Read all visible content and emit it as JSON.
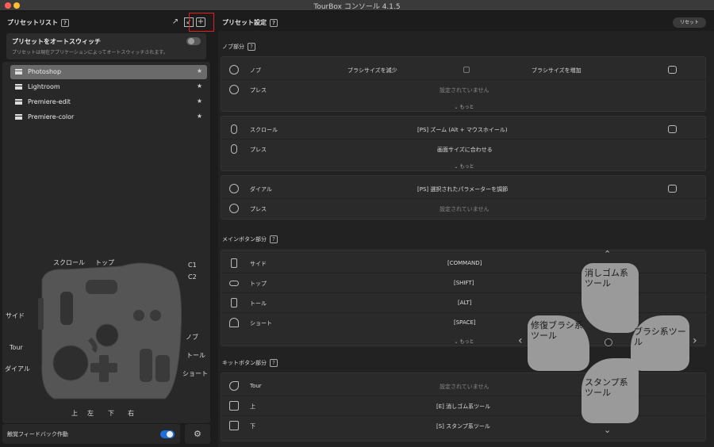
{
  "window": {
    "title": "TourBox コンソール 4.1.5"
  },
  "presets": {
    "header": "プリセットリスト",
    "help": "?",
    "auto_switch_title": "プリセットをオートスウィッチ",
    "auto_switch_desc": "プリセットは現在アプリケーションによってオートスウィッチされます。",
    "items": [
      {
        "label": "Photoshop",
        "star": "★"
      },
      {
        "label": "Lightroom",
        "star": "★"
      },
      {
        "label": "Premiere-edit",
        "star": "★"
      },
      {
        "label": "Premiere-color",
        "star": "★"
      }
    ]
  },
  "device": {
    "labels": {
      "scroll": "スクロール",
      "top": "トップ",
      "c1": "C1",
      "c2": "C2",
      "side": "サイド",
      "knob": "ノブ",
      "tour": "Tour",
      "tall": "トール",
      "dial": "ダイアル",
      "short": "ショート",
      "up": "上",
      "left": "左",
      "down": "下",
      "right": "右"
    }
  },
  "haptic": {
    "label": "触覚フィードバック作動"
  },
  "settings": {
    "header": "プリセット設定",
    "help": "?",
    "reset": "リセット",
    "knob_section": "ノブ部分",
    "knob": {
      "label": "ノブ",
      "left": "ブラシサイズを減少",
      "right": "ブラシサイズを増加",
      "press_label": "プレス",
      "press_value": "設定されていません",
      "more": "もっと"
    },
    "scroll": {
      "label": "スクロール",
      "value": "[PS] ズーム (Alt + マウスホイール)",
      "press_label": "プレス",
      "press_value": "画面サイズに合わせる",
      "more": "もっと"
    },
    "dial": {
      "label": "ダイアル",
      "value": "[PS] 選択されたパラメーターを調節",
      "press_label": "プレス",
      "press_value": "設定されていません"
    },
    "main_section": "メインボタン部分",
    "main": [
      {
        "label": "サイド",
        "value": "[COMMAND]"
      },
      {
        "label": "トップ",
        "value": "[SHIFT]"
      },
      {
        "label": "トール",
        "value": "[ALT]"
      },
      {
        "label": "ショート",
        "value": "[SPACE]"
      }
    ],
    "main_more": "もっと",
    "kit_section": "キットボタン部分",
    "kit": [
      {
        "label": "Tour",
        "value": "設定されていません"
      },
      {
        "label": "上",
        "value": "[E] 消しゴム系ツール"
      },
      {
        "label": "下",
        "value": "[S] スタンプ系ツール"
      }
    ]
  },
  "dpad": {
    "top": "消しゴム系ツール",
    "left": "修復ブラシ系ツール",
    "right": "ブラシ系ツール",
    "bottom": "スタンプ系ツール"
  },
  "colors": {
    "accent": "#1e6fd9",
    "highlight_box": "#e02020",
    "selected": "#6a6a6a"
  }
}
